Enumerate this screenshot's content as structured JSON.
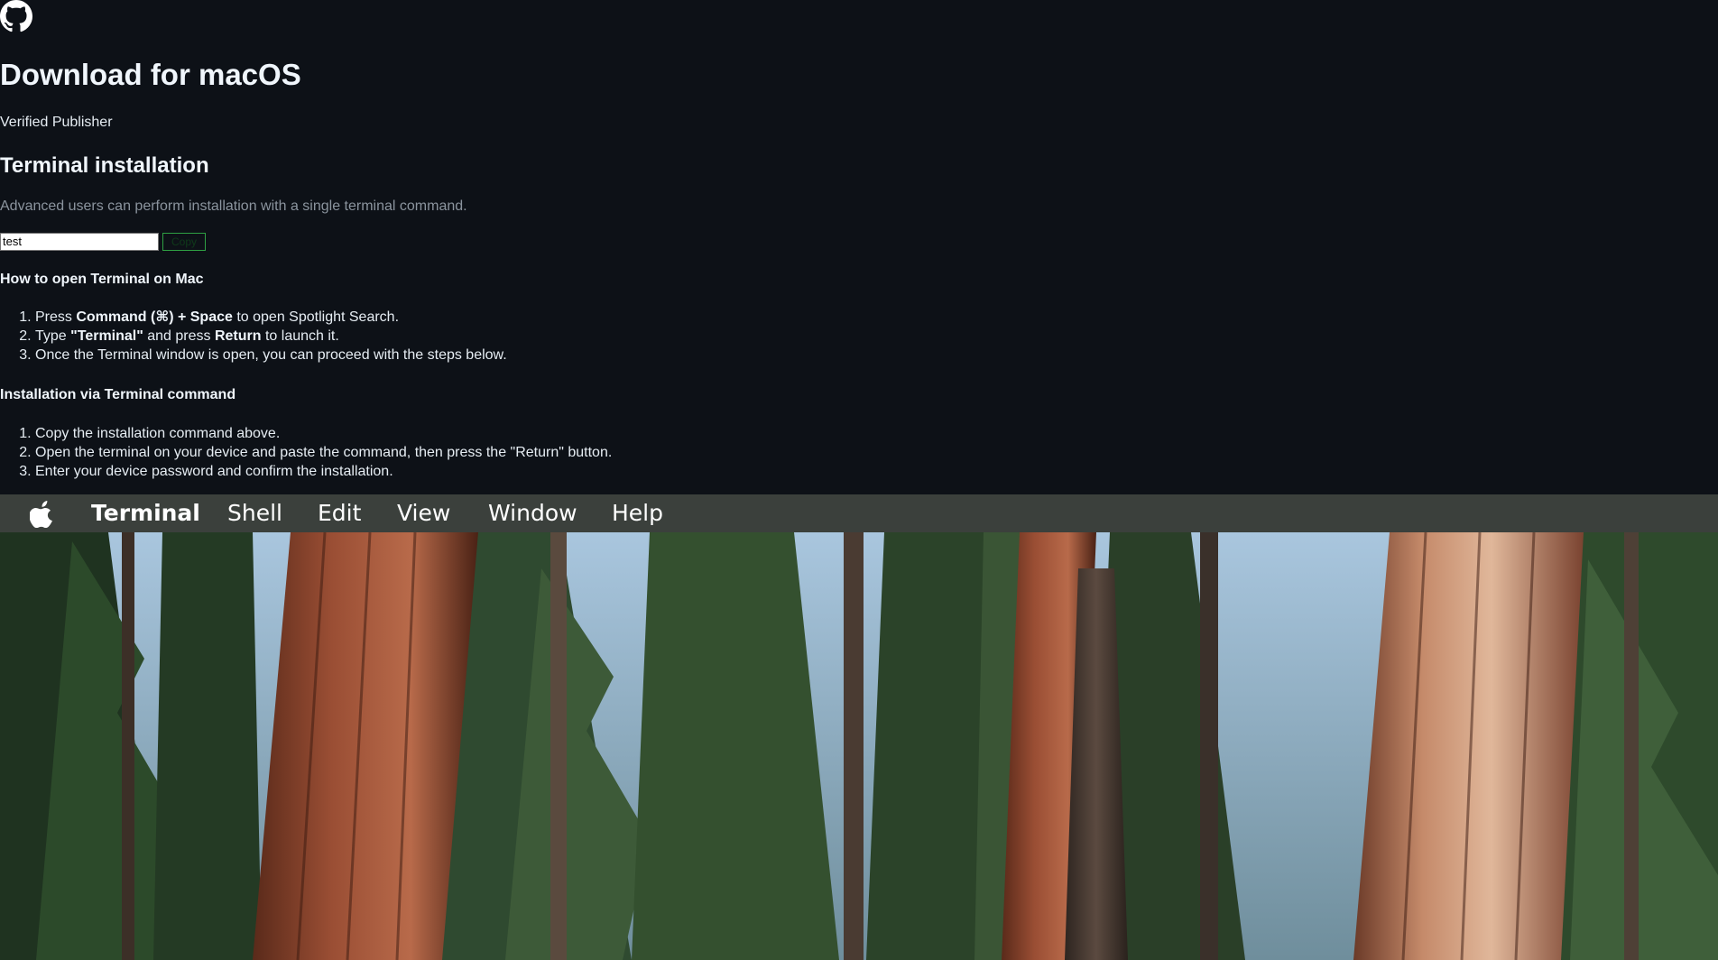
{
  "page": {
    "title": "Download for macOS",
    "publisher": "Verified Publisher"
  },
  "terminal_section": {
    "title": "Terminal installation",
    "lead": "Advanced users can perform installation with a single terminal command.",
    "command_value": "test",
    "copy_label": "Copy"
  },
  "how_to_open": {
    "title": "How to open Terminal on Mac",
    "steps": [
      {
        "pre": "Press ",
        "b1": "Command (⌘) + Space",
        "mid": " to open Spotlight Search.",
        "b2": "",
        "post": ""
      },
      {
        "pre": "Type ",
        "b1": "\"Terminal\"",
        "mid": " and press ",
        "b2": "Return",
        "post": " to launch it."
      },
      {
        "pre": "Once the Terminal window is open, you can proceed with the steps below.",
        "b1": "",
        "mid": "",
        "b2": "",
        "post": ""
      }
    ]
  },
  "install_via_terminal": {
    "title": "Installation via Terminal command",
    "steps": [
      "Copy the installation command above.",
      "Open the terminal on your device and paste the command, then press the \"Return\" button.",
      "Enter your device password and confirm the installation."
    ]
  },
  "menubar": {
    "icon": "apple-icon",
    "app_name": "Terminal",
    "items": [
      "Shell",
      "Edit",
      "View",
      "Window",
      "Help"
    ]
  },
  "colors": {
    "page_background": "#0d1117",
    "menubar_background": "#3b403c",
    "copy_button_border": "#2ea043",
    "muted_text": "#8b949e"
  }
}
